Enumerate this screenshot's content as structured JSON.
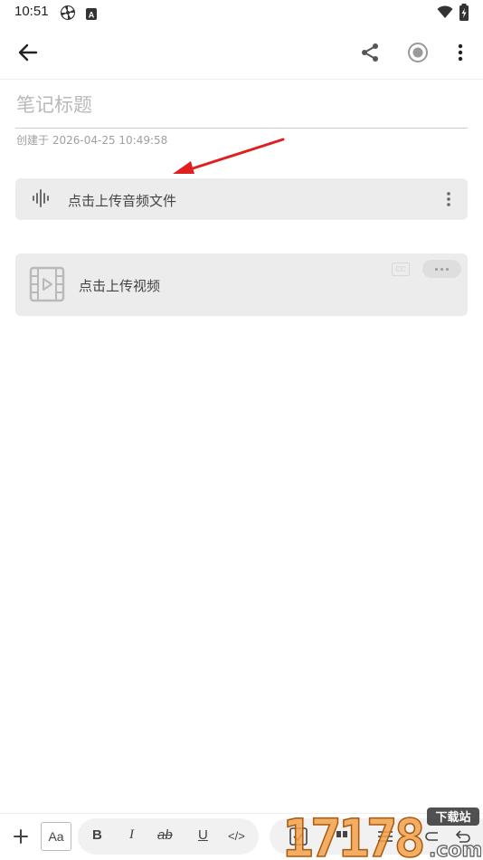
{
  "status_bar": {
    "time": "10:51",
    "icons": [
      "pinwheel-icon",
      "a-badge-icon",
      "wifi-icon",
      "battery-charging-icon"
    ]
  },
  "app_bar": {
    "back_icon": "arrow-left-icon",
    "share_icon": "share-icon",
    "record_icon": "record-icon",
    "more_icon": "more-vertical-icon"
  },
  "note": {
    "title_placeholder": "笔记标题",
    "created_label": "创建于",
    "created_time": "2026-04-25 10:49:58"
  },
  "audio_card": {
    "label": "点击上传音频文件",
    "icon": "audio-waveform-icon",
    "more_icon": "more-vertical-icon"
  },
  "video_card": {
    "label": "点击上传视频",
    "icon": "film-play-icon",
    "cc_label": "CC",
    "more_icon": "more-horizontal-icon"
  },
  "toolbar": {
    "aa_label": "Aa",
    "bold": "B",
    "italic": "I",
    "strike": "ab",
    "underline": "U",
    "code": "</>"
  },
  "watermark": {
    "number": "17178",
    "site": "下载站",
    "domain": ".com"
  },
  "colors": {
    "card_bg": "#ececec",
    "annotation_arrow": "#e02020",
    "placeholder_text": "#b9b9b9"
  }
}
